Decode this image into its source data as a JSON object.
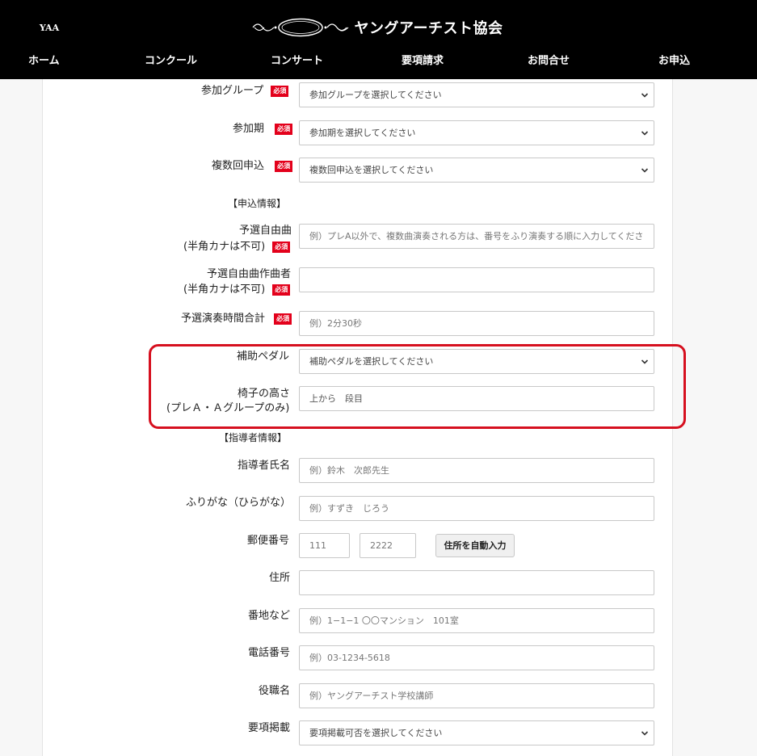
{
  "header": {
    "logo_badge": "YAA",
    "site_title": "ヤングアーチスト協会"
  },
  "nav": [
    {
      "label": "ホーム"
    },
    {
      "label": "コンクール"
    },
    {
      "label": "コンサート"
    },
    {
      "label": "要項請求"
    },
    {
      "label": "お問合せ"
    },
    {
      "label": "お申込"
    }
  ],
  "required_badge": "必須",
  "form": {
    "group": {
      "label": "参加グループ",
      "value": "参加グループを選択してください"
    },
    "period": {
      "label": "参加期",
      "value": "参加期を選択してください"
    },
    "multi": {
      "label": "複数回申込",
      "value": "複数回申込を選択してください"
    },
    "section_application": "【申込情報】",
    "piece": {
      "label1": "予選自由曲",
      "label2": "(半角カナは不可)",
      "placeholder": "例）プレA以外で、複数曲演奏される方は、番号をふり演奏する順に入力してくださ"
    },
    "composer": {
      "label1": "予選自由曲作曲者",
      "label2": "(半角カナは不可)",
      "placeholder": ""
    },
    "duration": {
      "label": "予選演奏時間合計",
      "placeholder": "例）2分30秒"
    },
    "pedal": {
      "label": "補助ペダル",
      "value": "補助ペダルを選択してください"
    },
    "chair": {
      "label1": "椅子の高さ",
      "label2": "(プレＡ・Ａグループのみ)",
      "placeholder": "上から　段目"
    },
    "section_teacher": "【指導者情報】",
    "teacher_name": {
      "label": "指導者氏名",
      "placeholder": "例）鈴木　次郎先生"
    },
    "furigana": {
      "label": "ふりがな（ひらがな）",
      "placeholder": "例）すずき　じろう"
    },
    "postal": {
      "label": "郵便番号",
      "placeholder1": "111",
      "placeholder2": "2222",
      "button": "住所を自動入力"
    },
    "address": {
      "label": "住所",
      "placeholder": ""
    },
    "address2": {
      "label": "番地など",
      "placeholder": "例）1−1−1 〇〇マンション　101室"
    },
    "phone": {
      "label": "電話番号",
      "placeholder": "例）03-1234-5618"
    },
    "title": {
      "label": "役職名",
      "placeholder": "例）ヤングアーチスト学校講師"
    },
    "listing": {
      "label": "要項掲載",
      "value": "要項掲載可否を選択してください"
    }
  },
  "colors": {
    "header_bg": "#000000",
    "required_badge": "#e3001b",
    "highlight_border": "#d6101f"
  }
}
